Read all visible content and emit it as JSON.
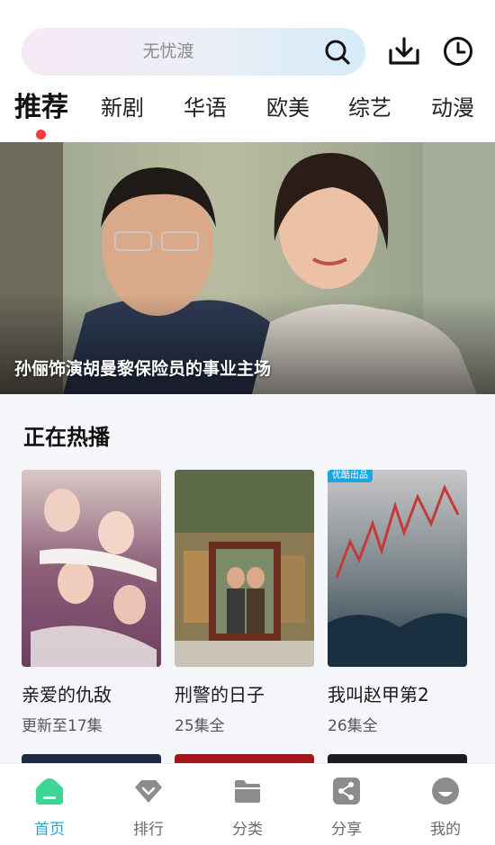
{
  "search": {
    "placeholder": "无忧渡"
  },
  "tabs": [
    {
      "label": "推荐",
      "active": true
    },
    {
      "label": "新剧"
    },
    {
      "label": "华语"
    },
    {
      "label": "欧美"
    },
    {
      "label": "综艺"
    },
    {
      "label": "动漫"
    }
  ],
  "banner": {
    "caption": "孙俪饰演胡曼黎保险员的事业主场"
  },
  "now_playing": {
    "title": "正在热播",
    "items": [
      {
        "title": "亲爱的仇敌",
        "subtitle": "更新至17集"
      },
      {
        "title": "刑警的日子",
        "subtitle": "25集全"
      },
      {
        "title": "我叫赵甲第2",
        "subtitle": "26集全",
        "badge": "优酷出品"
      }
    ]
  },
  "bottom_nav": [
    {
      "label": "首页",
      "icon": "home-icon",
      "active": true
    },
    {
      "label": "排行",
      "icon": "ranking-icon"
    },
    {
      "label": "分类",
      "icon": "folder-icon"
    },
    {
      "label": "分享",
      "icon": "share-icon"
    },
    {
      "label": "我的",
      "icon": "profile-icon"
    }
  ],
  "colors": {
    "accent": "#2aa6d8",
    "dot": "#f33b3b",
    "home_icon": "#3ed694",
    "section_bg": "#f5f6fa"
  }
}
